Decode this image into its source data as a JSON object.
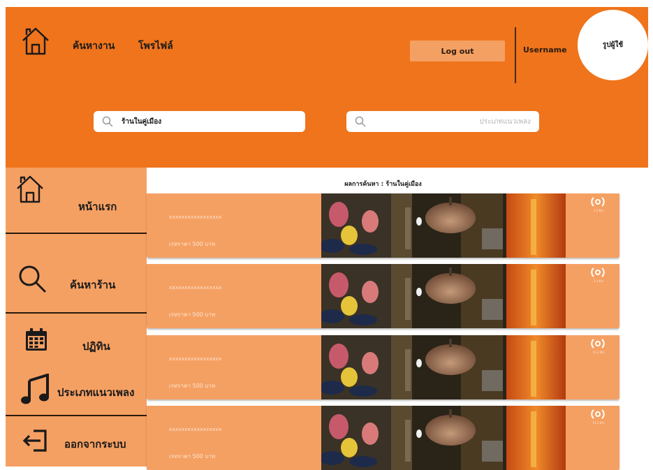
{
  "header": {
    "nav": [
      "ค้นหางาน",
      "โพรไฟล์"
    ],
    "logout_label": "Log out",
    "username": "Username",
    "avatar_label": "รูปผู้ใช้"
  },
  "search": {
    "location_value": "ร้านในคู่เมือง",
    "genre_placeholder": "ประเภทแนวเพลง"
  },
  "sidebar": {
    "items": [
      {
        "label": "หน้าแรก",
        "icon": "home-icon"
      },
      {
        "label": "ค้นหาร้าน",
        "icon": "search-icon"
      },
      {
        "label": "ปฏิทิน",
        "icon": "calendar-icon"
      },
      {
        "label": "ประเภทแนวเพลง",
        "icon": "music-note-icon"
      },
      {
        "label": "ออกจากระบบ",
        "icon": "logout-icon"
      }
    ]
  },
  "results": {
    "title": "ผลการค้นหา : ร้านในคู่เมือง",
    "cards": [
      {
        "name": "xxxxxxxxxxxxxxxxx",
        "price": "เรทราคา 500 บาท",
        "distance": "1.5 Km"
      },
      {
        "name": "xxxxxxxxxxxxxxxxx",
        "price": "เรทราคา 500 บาท",
        "distance": "3.1 Km"
      },
      {
        "name": "xxxxxxxxxxxxxxxxx",
        "price": "เรทราคา 500 บาท",
        "distance": "10.1 Km"
      },
      {
        "name": "xxxxxxxxxxxxxxxxx",
        "price": "เรทราคา 500 บาท",
        "distance": "11.2 Km"
      }
    ]
  },
  "colors": {
    "header_orange": "#ef741c",
    "panel_orange": "#f5a063",
    "button_orange": "#f5a063"
  }
}
